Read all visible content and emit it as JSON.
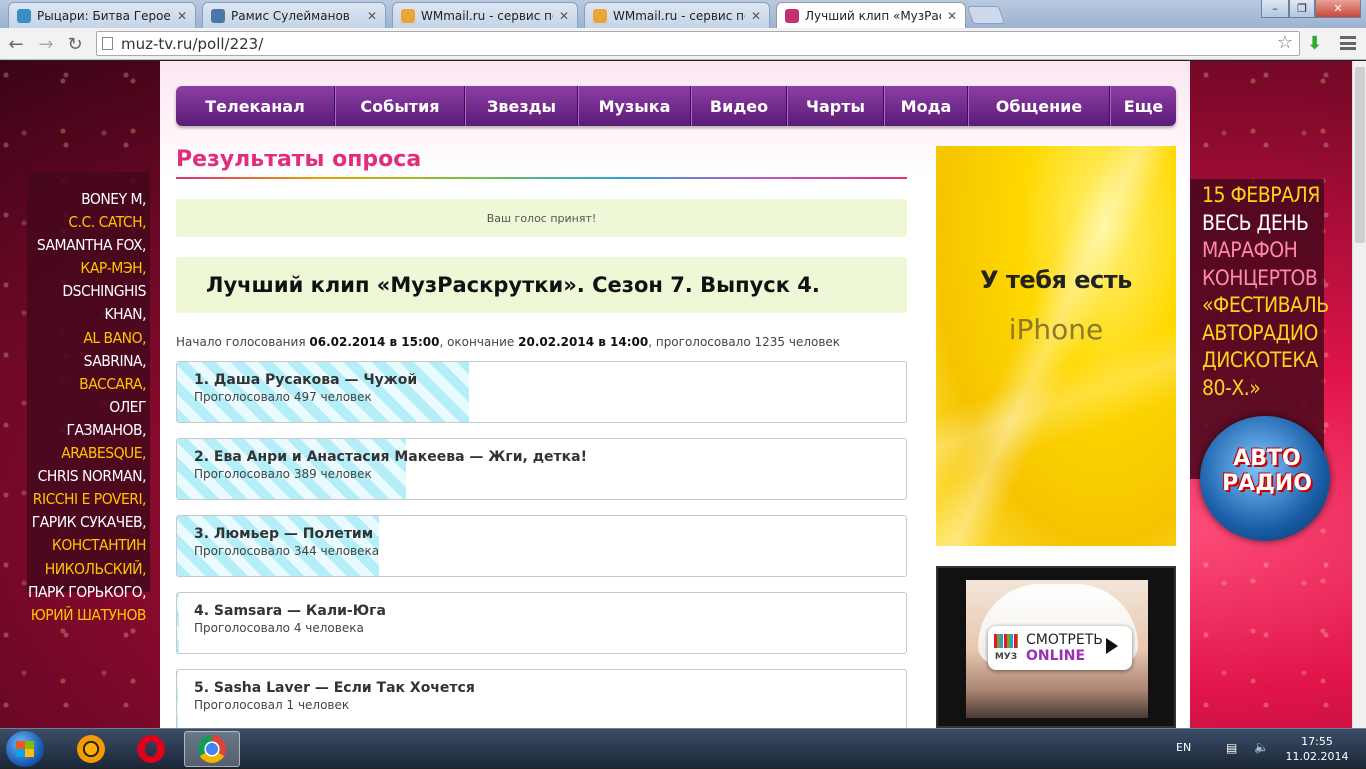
{
  "browser": {
    "tabs": [
      {
        "label": "Рыцари: Битва Героев",
        "icon_color": "#3b8ec2",
        "active": false
      },
      {
        "label": "Рамис Сулейманов",
        "icon_color": "#4a76a8",
        "active": false
      },
      {
        "label": "WMmail.ru - сервис почт",
        "icon_color": "#e9a43a",
        "active": false
      },
      {
        "label": "WMmail.ru - сервис почт",
        "icon_color": "#e9a43a",
        "active": false
      },
      {
        "label": "Лучший клип «МузРаскр",
        "icon_color": "#c2316e",
        "active": true
      }
    ],
    "url": "muz-tv.ru/poll/223/",
    "window_controls": {
      "minimize": "–",
      "maximize": "❐",
      "close": "✕"
    }
  },
  "nav": {
    "items": [
      "Телеканал",
      "События",
      "Звезды",
      "Музыка",
      "Видео",
      "Чарты",
      "Мода",
      "Общение",
      "Еще"
    ]
  },
  "heading": "Результаты опроса",
  "notice": "Ваш голос принят!",
  "poll": {
    "title": "Лучший клип «МузРаскрутки». Сезон 7. Выпуск 4.",
    "meta_prefix": "Начало голосования",
    "start": "06.02.2014 в 15:00",
    "meta_mid": ", окончание",
    "end": "20.02.2014 в 14:00",
    "meta_suffix": ", проголосовало 1235 человек",
    "options": [
      {
        "title": "1. Даша Русакова — Чужой",
        "votes_text": "Проголосовало 497 человек",
        "votes": 497
      },
      {
        "title": "2. Ева Анри и Анастасия Макеева — Жги, детка!",
        "votes_text": "Проголосовало 389 человек",
        "votes": 389
      },
      {
        "title": "3. Люмьер — Полетим",
        "votes_text": "Проголосовало 344 человека",
        "votes": 344
      },
      {
        "title": "4. Samsara — Кали-Юга",
        "votes_text": "Проголосовало 4 человека",
        "votes": 4
      },
      {
        "title": "5. Sasha Laver — Если Так Хочется",
        "votes_text": "Проголосовал 1 человек",
        "votes": 1
      }
    ]
  },
  "left_banner": [
    {
      "text": "BONEY M,",
      "color": "white"
    },
    {
      "text": "C.C. CATCH,",
      "color": "yellow"
    },
    {
      "text": "SAMANTHA FOX,",
      "color": "white"
    },
    {
      "text": "КАР-МЭН,",
      "color": "yellow"
    },
    {
      "text": "DSCHINGHIS KHAN,",
      "color": "white"
    },
    {
      "text": "AL BANO,",
      "color": "yellow"
    },
    {
      "text": "SABRINA,",
      "color": "white"
    },
    {
      "text": "BACCARA,",
      "color": "yellow"
    },
    {
      "text": "ОЛЕГ ГАЗМАНОВ,",
      "color": "white"
    },
    {
      "text": "ARABESQUE,",
      "color": "yellow"
    },
    {
      "text": "CHRIS NORMAN,",
      "color": "white"
    },
    {
      "text": "RICCHI E POVERI,",
      "color": "yellow"
    },
    {
      "text": "ГАРИК СУКАЧЕВ,",
      "color": "white"
    },
    {
      "text": "КОНСТАНТИН",
      "color": "yellow"
    },
    {
      "text": "НИКОЛЬСКИЙ,",
      "color": "yellow"
    },
    {
      "text": "ПАРК ГОРЬКОГО,",
      "color": "white"
    },
    {
      "text": "ЮРИЙ ШАТУНОВ",
      "color": "yellow"
    }
  ],
  "right_banner": [
    {
      "text": "15 ФЕВРАЛЯ",
      "color": "yellow"
    },
    {
      "text": "ВЕСЬ ДЕНЬ",
      "color": "white"
    },
    {
      "text": "МАРАФОН",
      "color": "pink"
    },
    {
      "text": "КОНЦЕРТОВ",
      "color": "pink"
    },
    {
      "text": "«ФЕСТИВАЛЬ",
      "color": "yellow"
    },
    {
      "text": "АВТОРАДИО",
      "color": "yellow"
    },
    {
      "text": "ДИСКОТЕКА",
      "color": "yellow"
    },
    {
      "text": "80-Х.»",
      "color": "yellow"
    }
  ],
  "autoradio": {
    "line1": "АВТО",
    "line2": "РАДИО"
  },
  "ad_iphone": {
    "line1": "У тебя есть",
    "line2": "iPhone"
  },
  "ad_muz": {
    "logo": "МУЗ",
    "line1": "СМОТРЕТЬ",
    "line2": "ONLINE"
  },
  "taskbar": {
    "apps": [
      "aimp-icon",
      "opera-icon",
      "chrome-icon"
    ],
    "lang": "EN",
    "time": "17:55",
    "date": "11.02.2014"
  }
}
